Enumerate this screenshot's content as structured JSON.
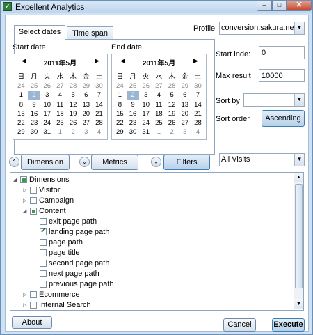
{
  "window": {
    "title": "Excellent Analytics",
    "minimize_glyph": "‒",
    "maximize_glyph": "□",
    "close_glyph": "✕",
    "icon": "app-icon"
  },
  "tabs": [
    {
      "label": "Select dates"
    },
    {
      "label": "Time span"
    }
  ],
  "start_date": {
    "label": "Start date",
    "month": "2011年5月",
    "prev": "◀",
    "next": "▶",
    "weekdays": [
      "日",
      "月",
      "火",
      "水",
      "木",
      "金",
      "土"
    ],
    "weeks": [
      [
        "24",
        "25",
        "26",
        "27",
        "28",
        "29",
        "30"
      ],
      [
        "1",
        "2",
        "3",
        "4",
        "5",
        "6",
        "7"
      ],
      [
        "8",
        "9",
        "10",
        "11",
        "12",
        "13",
        "14"
      ],
      [
        "15",
        "16",
        "17",
        "18",
        "19",
        "20",
        "21"
      ],
      [
        "22",
        "23",
        "24",
        "25",
        "26",
        "27",
        "28"
      ],
      [
        "29",
        "30",
        "31",
        "1",
        "2",
        "3",
        "4"
      ]
    ],
    "selected": "2"
  },
  "end_date": {
    "label": "End date",
    "month": "2011年5月",
    "prev": "◀",
    "next": "▶",
    "weekdays": [
      "日",
      "月",
      "火",
      "水",
      "木",
      "金",
      "土"
    ],
    "weeks": [
      [
        "24",
        "25",
        "26",
        "27",
        "28",
        "29",
        "30"
      ],
      [
        "1",
        "2",
        "3",
        "4",
        "5",
        "6",
        "7"
      ],
      [
        "8",
        "9",
        "10",
        "11",
        "12",
        "13",
        "14"
      ],
      [
        "15",
        "16",
        "17",
        "18",
        "19",
        "20",
        "21"
      ],
      [
        "22",
        "23",
        "24",
        "25",
        "26",
        "27",
        "28"
      ],
      [
        "29",
        "30",
        "31",
        "1",
        "2",
        "3",
        "4"
      ]
    ],
    "selected": "2"
  },
  "profile": {
    "label": "Profile",
    "value": "conversion.sakura.ne.jp"
  },
  "start_index": {
    "label": "Start inde:",
    "value": "0"
  },
  "max_result": {
    "label": "Max result",
    "value": "10000"
  },
  "sort_by": {
    "label": "Sort by",
    "value": ""
  },
  "sort_order": {
    "label": "Sort order",
    "button": "Ascending"
  },
  "toolbar": {
    "dimension": "Dimension",
    "metrics": "Metrics",
    "filters": "Filters",
    "expand_glyph": "⌃",
    "collapse_glyph": "⌄"
  },
  "segment": {
    "value": "All Visits"
  },
  "combo_arrow": "▼",
  "tree": [
    {
      "label": "Dimensions",
      "level": 0,
      "expander": "◢",
      "check": "partial"
    },
    {
      "label": "Visitor",
      "level": 1,
      "expander": "▷",
      "check": "none"
    },
    {
      "label": "Campaign",
      "level": 1,
      "expander": "▷",
      "check": "none"
    },
    {
      "label": "Content",
      "level": 1,
      "expander": "◢",
      "check": "partial"
    },
    {
      "label": "exit page path",
      "level": 2,
      "expander": "",
      "check": "none"
    },
    {
      "label": "landing page path",
      "level": 2,
      "expander": "",
      "check": "checked"
    },
    {
      "label": "page path",
      "level": 2,
      "expander": "",
      "check": "none"
    },
    {
      "label": "page title",
      "level": 2,
      "expander": "",
      "check": "none"
    },
    {
      "label": "second page path",
      "level": 2,
      "expander": "",
      "check": "none"
    },
    {
      "label": "next page path",
      "level": 2,
      "expander": "",
      "check": "none"
    },
    {
      "label": "previous page path",
      "level": 2,
      "expander": "",
      "check": "none"
    },
    {
      "label": "Ecommerce",
      "level": 1,
      "expander": "▷",
      "check": "none"
    },
    {
      "label": "Internal Search",
      "level": 1,
      "expander": "▷",
      "check": "none"
    }
  ],
  "scrollbar": {
    "up": "▲",
    "down": "▼"
  },
  "footer": {
    "about": "About",
    "cancel": "Cancel",
    "execute": "Execute"
  }
}
